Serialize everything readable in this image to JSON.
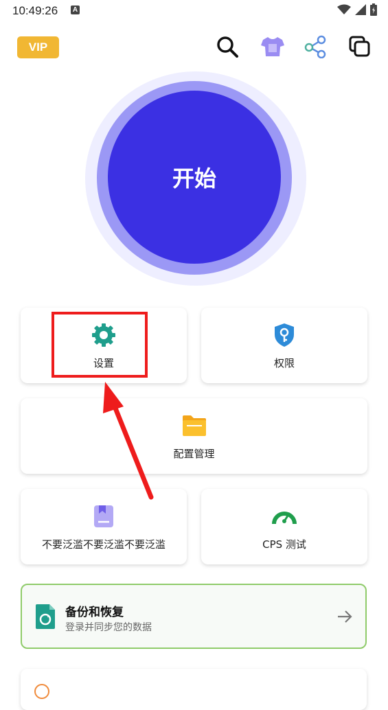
{
  "status_bar": {
    "time": "10:49:26",
    "notif_icon": "A"
  },
  "header": {
    "vip_label": "VIP",
    "icons": [
      "search-icon",
      "shirt-icon",
      "share-icon",
      "copy-icon"
    ]
  },
  "start_button": {
    "label": "开始"
  },
  "cards": {
    "settings": {
      "label": "设置",
      "icon": "gear-icon"
    },
    "permissions": {
      "label": "权限",
      "icon": "shield-key-icon"
    },
    "config": {
      "label": "配置管理",
      "icon": "folder-icon"
    },
    "flood": {
      "label": "不要泛滥不要泛滥不要泛滥",
      "icon": "bookmark-icon"
    },
    "cps": {
      "label": "CPS 测试",
      "icon": "speedometer-icon"
    }
  },
  "backup": {
    "title": "备份和恢复",
    "subtitle": "登录并同步您的数据",
    "icon": "sync-document-icon"
  },
  "colors": {
    "accent": "#3b30e3",
    "teal": "#1f9e8c",
    "vip": "#f1b733",
    "highlight": "#ee1c1c"
  }
}
